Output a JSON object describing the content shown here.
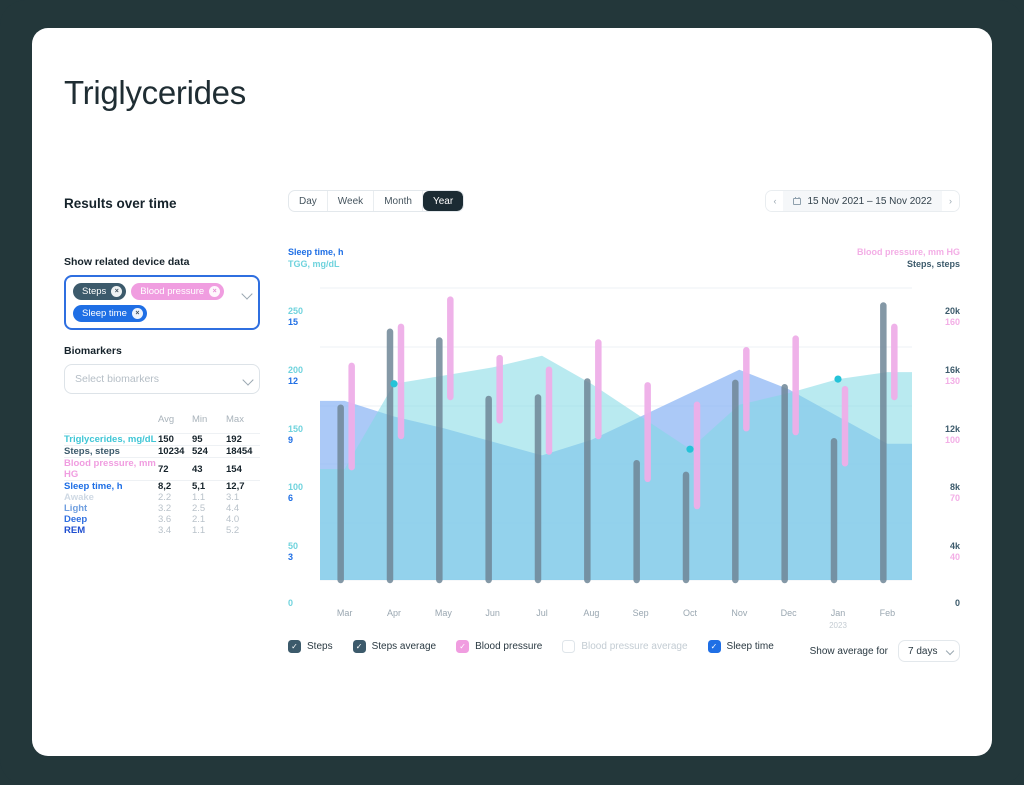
{
  "page": {
    "title": "Triglycerides",
    "section_title": "Results over time",
    "bg_color": "#23373a",
    "card_color": "#ffffff"
  },
  "left_panel": {
    "device_label": "Show related device data",
    "device_chips": [
      {
        "label": "Steps",
        "color": "#3c5a6b",
        "remove": "×"
      },
      {
        "label": "Blood pressure",
        "color": "#f09de0",
        "remove": "×"
      },
      {
        "label": "Sleep time",
        "color": "#1f6fe5",
        "remove": "×"
      }
    ],
    "biomarkers_label": "Biomarkers",
    "biomarkers_placeholder": "Select biomarkers"
  },
  "stats_table": {
    "headers": {
      "name": "",
      "avg": "Avg",
      "min": "Min",
      "max": "Max"
    },
    "rows": [
      {
        "name": "Triglycerides, mg/dL",
        "avg": "150",
        "min": "95",
        "max": "192",
        "color": "#3fc6d6"
      },
      {
        "name": "Steps, steps",
        "avg": "10234",
        "min": "524",
        "max": "18454",
        "color": "#3c5a6b"
      },
      {
        "name": "Blood pressure, mm HG",
        "avg": "72",
        "min": "43",
        "max": "154",
        "color": "#f09de0"
      },
      {
        "name": "Sleep time, h",
        "avg": "8,2",
        "min": "5,1",
        "max": "12,7",
        "color": "#1f6fe5"
      },
      {
        "name": "Awake",
        "avg": "2.2",
        "min": "1.1",
        "max": "3.1",
        "color": "#cfd9e4"
      },
      {
        "name": "Light",
        "avg": "3.2",
        "min": "2.5",
        "max": "4.4",
        "color": "#6f9fe0"
      },
      {
        "name": "Deep",
        "avg": "3.6",
        "min": "2.1",
        "max": "4.0",
        "color": "#2f6fe0"
      },
      {
        "name": "REM",
        "avg": "3.4",
        "min": "1.1",
        "max": "5.2",
        "color": "#1f4fd0"
      }
    ]
  },
  "controls": {
    "range_tabs": [
      {
        "label": "Day",
        "active": false
      },
      {
        "label": "Week",
        "active": false
      },
      {
        "label": "Month",
        "active": false
      },
      {
        "label": "Year",
        "active": true
      }
    ],
    "date_range": "15 Nov 2021 – 15 Nov 2022",
    "prev": "‹",
    "next": "›",
    "avg_label": "Show average for",
    "avg_value": "7 days"
  },
  "legend": [
    {
      "label": "Steps",
      "checked": true,
      "style": "slate"
    },
    {
      "label": "Steps average",
      "checked": true,
      "style": "slate"
    },
    {
      "label": "Blood pressure",
      "checked": true,
      "style": "pink"
    },
    {
      "label": "Blood pressure average",
      "checked": false,
      "style": "empty"
    },
    {
      "label": "Sleep time",
      "checked": true,
      "style": "blue"
    }
  ],
  "chart_data": {
    "type": "mixed",
    "title": "Results over time",
    "axis_titles": {
      "left_top": "Sleep time, h",
      "left_bottom": "TGG, mg/dL",
      "right_top": "Blood pressure, mm HG",
      "right_bottom": "Steps, steps"
    },
    "categories": [
      "Mar",
      "Apr",
      "May",
      "Jun",
      "Jul",
      "Aug",
      "Sep",
      "Oct",
      "Nov",
      "Dec",
      "Jan",
      "Feb"
    ],
    "x_sub_labels": {
      "Jan": "2023"
    },
    "axes": {
      "left_tgg": {
        "ticks": [
          "250",
          "200",
          "150",
          "100",
          "50",
          "0"
        ],
        "min": 0,
        "max": 250,
        "color": "#6fd3dd"
      },
      "left_sleep": {
        "ticks": [
          "15",
          "12",
          "9",
          "6",
          "3",
          "0"
        ],
        "min": 0,
        "max": 15,
        "color": "#1f6fe5"
      },
      "right_steps": {
        "ticks": [
          "20k",
          "16k",
          "12k",
          "8k",
          "4k",
          "0"
        ],
        "min": 0,
        "max": 20000,
        "color": "#3c5a6b"
      },
      "right_bp": {
        "ticks": [
          "160",
          "130",
          "100",
          "70",
          "40",
          ""
        ],
        "min": 10,
        "max": 160,
        "color": "#f3aee6"
      }
    },
    "grid": true,
    "legend_position": "bottom",
    "series": [
      {
        "name": "TGG, mg/dL",
        "type": "area",
        "color": "#7fd9e3",
        "axis": "left_tgg",
        "values": [
          95,
          168,
          175,
          182,
          192,
          168,
          140,
          112,
          150,
          160,
          172,
          178
        ],
        "markers": [
          {
            "category": "Apr",
            "value": 168
          },
          {
            "category": "Oct",
            "value": 112
          },
          {
            "category": "Jan",
            "value": 172
          }
        ]
      },
      {
        "name": "Sleep time",
        "type": "area",
        "color": "#8ab4f4",
        "axis": "left_sleep",
        "values": [
          9.2,
          8.4,
          7.8,
          7.1,
          6.4,
          7.2,
          8.4,
          9.6,
          10.8,
          9.8,
          8.4,
          7.0
        ]
      },
      {
        "name": "Steps",
        "type": "bar",
        "color": "#6e8697",
        "axis": "right_steps",
        "values": [
          11800,
          17000,
          16400,
          12400,
          12500,
          13600,
          8000,
          7200,
          13500,
          13200,
          9500,
          18800
        ]
      },
      {
        "name": "Blood pressure",
        "type": "range-bar",
        "color": "#eeaee8",
        "axis": "right_bp",
        "ranges": [
          {
            "category": "Mar",
            "low": 68,
            "high": 120
          },
          {
            "category": "Apr",
            "low": 84,
            "high": 140
          },
          {
            "category": "May",
            "low": 104,
            "high": 154
          },
          {
            "category": "Jun",
            "low": 92,
            "high": 124
          },
          {
            "category": "Jul",
            "low": 76,
            "high": 118
          },
          {
            "category": "Aug",
            "low": 84,
            "high": 132
          },
          {
            "category": "Sep",
            "low": 62,
            "high": 110
          },
          {
            "category": "Oct",
            "low": 48,
            "high": 100
          },
          {
            "category": "Nov",
            "low": 88,
            "high": 128
          },
          {
            "category": "Dec",
            "low": 86,
            "high": 134
          },
          {
            "category": "Jan",
            "low": 70,
            "high": 108
          },
          {
            "category": "Feb",
            "low": 104,
            "high": 140
          }
        ]
      }
    ]
  }
}
